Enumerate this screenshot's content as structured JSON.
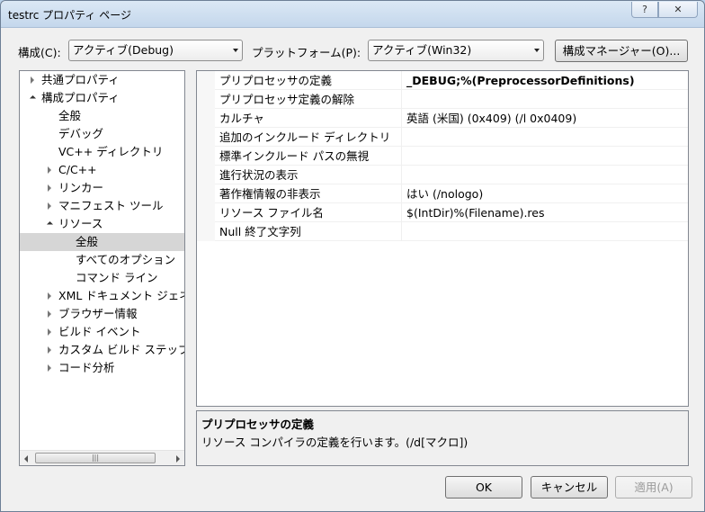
{
  "window": {
    "title": "testrc プロパティ ページ",
    "help_label": "?",
    "close_label": "✕"
  },
  "toolbar": {
    "config_label": "構成(C):",
    "config_value": "アクティブ(Debug)",
    "platform_label": "プラットフォーム(P):",
    "platform_value": "アクティブ(Win32)",
    "config_manager_label": "構成マネージャー(O)..."
  },
  "tree": [
    {
      "label": "共通プロパティ",
      "state": "collapsed"
    },
    {
      "label": "構成プロパティ",
      "state": "expanded"
    },
    {
      "label": "全般",
      "state": "leaf"
    },
    {
      "label": "デバッグ",
      "state": "leaf"
    },
    {
      "label": "VC++ ディレクトリ",
      "state": "leaf"
    },
    {
      "label": "C/C++",
      "state": "collapsed"
    },
    {
      "label": "リンカー",
      "state": "collapsed"
    },
    {
      "label": "マニフェスト ツール",
      "state": "collapsed"
    },
    {
      "label": "リソース",
      "state": "expanded"
    },
    {
      "label": "全般",
      "state": "leaf",
      "selected": true
    },
    {
      "label": "すべてのオプション",
      "state": "leaf"
    },
    {
      "label": "コマンド ライン",
      "state": "leaf"
    },
    {
      "label": "XML ドキュメント ジェネ",
      "state": "collapsed"
    },
    {
      "label": "ブラウザー情報",
      "state": "collapsed"
    },
    {
      "label": "ビルド イベント",
      "state": "collapsed"
    },
    {
      "label": "カスタム ビルド ステップ",
      "state": "collapsed"
    },
    {
      "label": "コード分析",
      "state": "collapsed"
    }
  ],
  "scrollbar": {
    "grip": "|||"
  },
  "properties": [
    {
      "name": "プリプロセッサの定義",
      "value": "_DEBUG;%(PreprocessorDefinitions)"
    },
    {
      "name": "プリプロセッサ定義の解除",
      "value": ""
    },
    {
      "name": "カルチャ",
      "value": "英語 (米国) (0x409) (/l 0x0409)"
    },
    {
      "name": "追加のインクルード ディレクトリ",
      "value": ""
    },
    {
      "name": "標準インクルード パスの無視",
      "value": ""
    },
    {
      "name": "進行状況の表示",
      "value": ""
    },
    {
      "name": "著作権情報の非表示",
      "value": "はい (/nologo)"
    },
    {
      "name": "リソース ファイル名",
      "value": "$(IntDir)%(Filename).res"
    },
    {
      "name": "Null 終了文字列",
      "value": ""
    }
  ],
  "description": {
    "title": "プリプロセッサの定義",
    "text": "リソース コンパイラの定義を行います。(/d[マクロ])"
  },
  "buttons": {
    "ok": "OK",
    "cancel": "キャンセル",
    "apply": "適用(A)"
  }
}
